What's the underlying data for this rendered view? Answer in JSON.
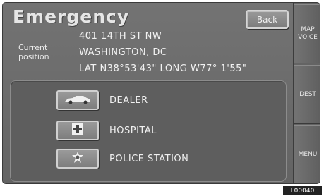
{
  "screen": {
    "title": "Emergency",
    "back_label": "Back"
  },
  "position": {
    "label_line1": "Current",
    "label_line2": "position",
    "address_line1": "401 14TH ST NW",
    "address_line2": "WASHINGTON, DC",
    "coordinates": "LAT N38°53'43\" LONG W77° 1'55\""
  },
  "categories": [
    {
      "label": "DEALER",
      "icon": "car-icon"
    },
    {
      "label": "HOSPITAL",
      "icon": "hospital-cross-icon"
    },
    {
      "label": "POLICE STATION",
      "icon": "police-badge-icon"
    }
  ],
  "side_menu": {
    "map_voice_line1": "MAP",
    "map_voice_line2": "VOICE",
    "dest_label": "DEST",
    "menu_label": "MENU"
  },
  "figure_code": "L00040",
  "colors": {
    "screen_bg": "#6a6a6a",
    "panel_bg": "#5e5e5e",
    "text": "#f0f0f0"
  }
}
